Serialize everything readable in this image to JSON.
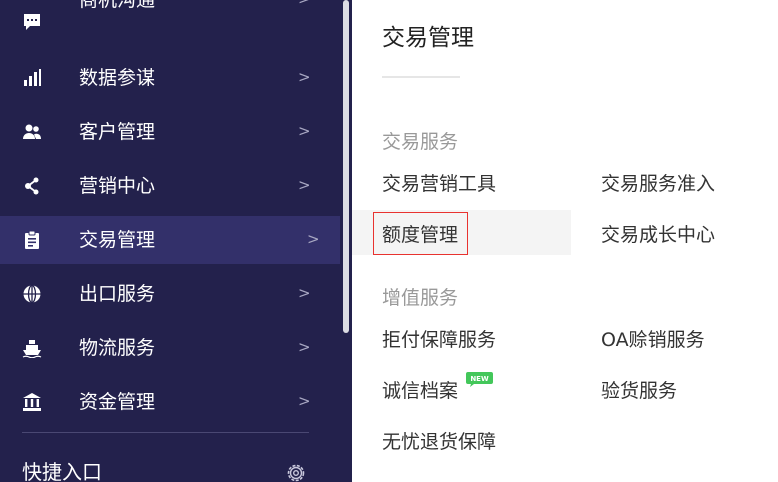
{
  "sidebar": {
    "items": [
      {
        "label": "商机沟通",
        "icon": "chat-icon",
        "arrow": ">"
      },
      {
        "label": "数据参谋",
        "icon": "bar-chart-icon",
        "arrow": ">"
      },
      {
        "label": "客户管理",
        "icon": "users-icon",
        "arrow": ">"
      },
      {
        "label": "营销中心",
        "icon": "network-icon",
        "arrow": ">"
      },
      {
        "label": "交易管理",
        "icon": "clipboard-icon",
        "arrow": ">",
        "active": true
      },
      {
        "label": "出口服务",
        "icon": "globe-icon",
        "arrow": ">"
      },
      {
        "label": "物流服务",
        "icon": "ship-icon",
        "arrow": ">"
      },
      {
        "label": "资金管理",
        "icon": "bank-icon",
        "arrow": ">"
      }
    ],
    "shortcut": {
      "label": "快捷入口",
      "icon": "gear-icon"
    }
  },
  "panel": {
    "title": "交易管理",
    "sections": [
      {
        "title": "交易服务",
        "links": [
          {
            "label": "交易营销工具"
          },
          {
            "label": "交易服务准入"
          },
          {
            "label": "额度管理",
            "highlighted": true
          },
          {
            "label": "交易成长中心"
          }
        ]
      },
      {
        "title": "增值服务",
        "links": [
          {
            "label": "拒付保障服务"
          },
          {
            "label": "OA赊销服务"
          },
          {
            "label": "诚信档案",
            "badge": "NEW"
          },
          {
            "label": "验货服务"
          },
          {
            "label": "无忧退货保障"
          }
        ]
      }
    ]
  },
  "colors": {
    "sidebar_bg": "#23214c",
    "sidebar_active_bg": "#33306a",
    "highlight_border": "#e8322f",
    "badge_green": "#43c75a",
    "section_title": "#999999"
  }
}
